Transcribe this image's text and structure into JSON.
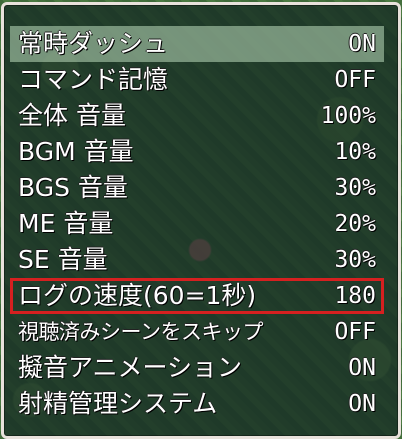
{
  "options": [
    {
      "label": "常時ダッシュ",
      "value": "ON"
    },
    {
      "label": "コマンド記憶",
      "value": "OFF"
    },
    {
      "label": "全体 音量",
      "value": "100%"
    },
    {
      "label": "BGM 音量",
      "value": "10%"
    },
    {
      "label": "BGS 音量",
      "value": "30%"
    },
    {
      "label": "ME 音量",
      "value": "20%"
    },
    {
      "label": "SE 音量",
      "value": "30%"
    },
    {
      "label": "ログの速度(60=1秒)",
      "value": "180"
    },
    {
      "label": "視聴済みシーンをスキップ",
      "value": "OFF"
    },
    {
      "label": "擬音アニメーション",
      "value": "ON"
    },
    {
      "label": "射精管理システム",
      "value": "ON"
    }
  ],
  "selected_index": 0,
  "highlighted_index": 7,
  "colors": {
    "window_border": "#e9e2dc",
    "selected_row": "#a8c7a8",
    "highlight_outline": "#d62020",
    "text": "#ffffff"
  }
}
